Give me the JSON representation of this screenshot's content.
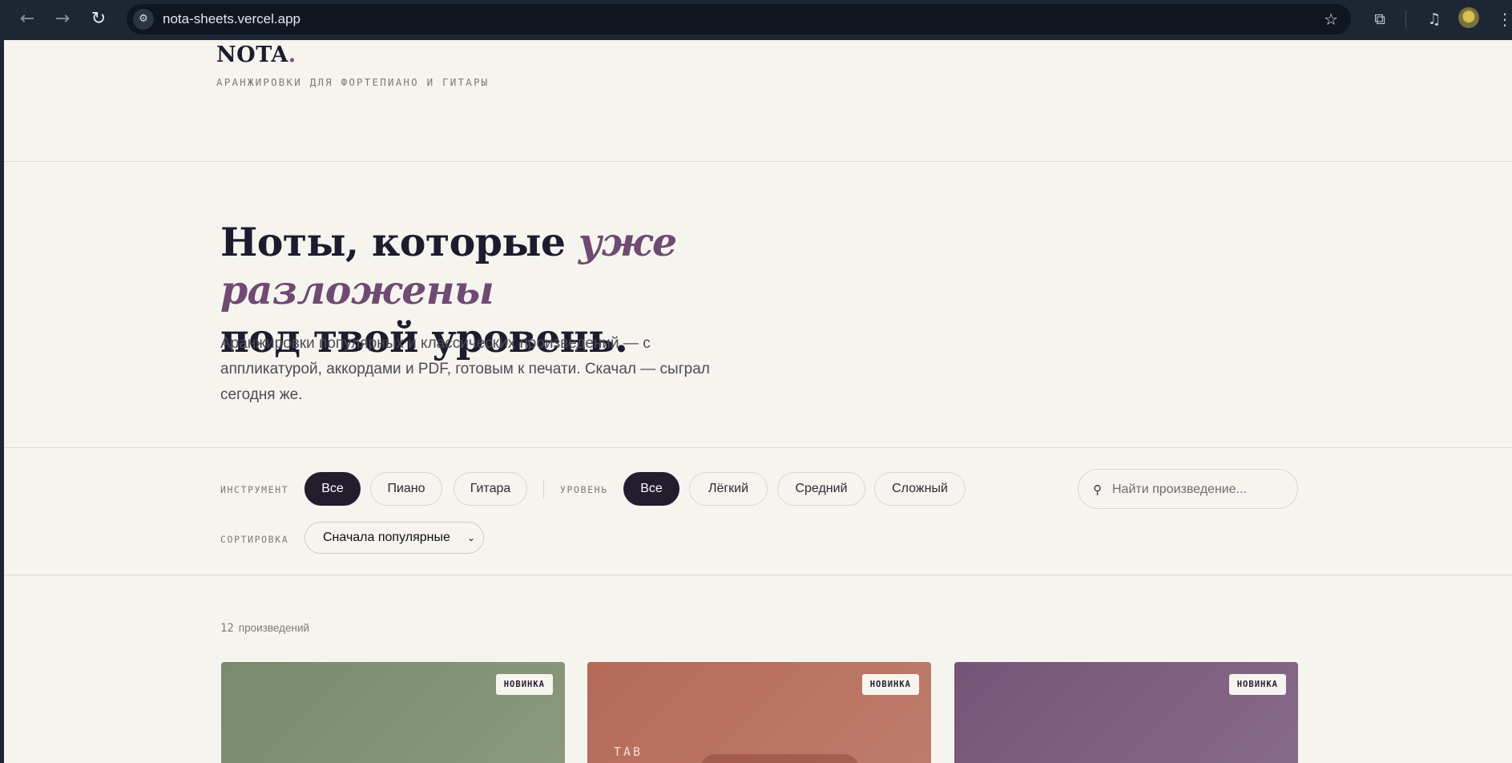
{
  "browser": {
    "url": "nota-sheets.vercel.app",
    "icons": {
      "back": "arrow-left-icon",
      "forward": "arrow-right-icon",
      "reload": "reload-icon",
      "site_info": "tune-icon",
      "bookmark": "star-icon",
      "extensions": "puzzle-icon",
      "media": "queue-music-icon",
      "menu": "kebab-menu-icon"
    }
  },
  "header": {
    "logo": "NOTA",
    "logo_dot": ".",
    "tagline": "АРАНЖИРОВКИ ДЛЯ ФОРТЕПИАНО И ГИТАРЫ"
  },
  "hero": {
    "title_start": "Ноты, которые ",
    "title_accent": "уже разложены",
    "title_end": "под твой уровень.",
    "subtitle": "Аранжировки популярных и классических произведений — с аппликатурой, аккордами и PDF, готовым к печати. Скачал — сыграл сегодня же."
  },
  "filters": {
    "instrument_label": "ИНСТРУМЕНТ",
    "instrument_options": [
      "Все",
      "Пиано",
      "Гитара"
    ],
    "instrument_selected": "Все",
    "level_label": "УРОВЕНЬ",
    "level_options": [
      "Все",
      "Лёгкий",
      "Средний",
      "Сложный"
    ],
    "level_selected": "Все",
    "sort_label": "СОРТИРОВКА",
    "sort_value": "Сначала популярные",
    "search_placeholder": "Найти произведение..."
  },
  "results": {
    "count": "12",
    "count_label": "произведений"
  },
  "cards": [
    {
      "badge": "НОВИНКА",
      "color": "#7a8a6c",
      "type": ""
    },
    {
      "badge": "НОВИНКА",
      "color": "#b56a58",
      "type": "TAB"
    },
    {
      "badge": "НОВИНКА",
      "color": "#765479",
      "type": ""
    }
  ]
}
